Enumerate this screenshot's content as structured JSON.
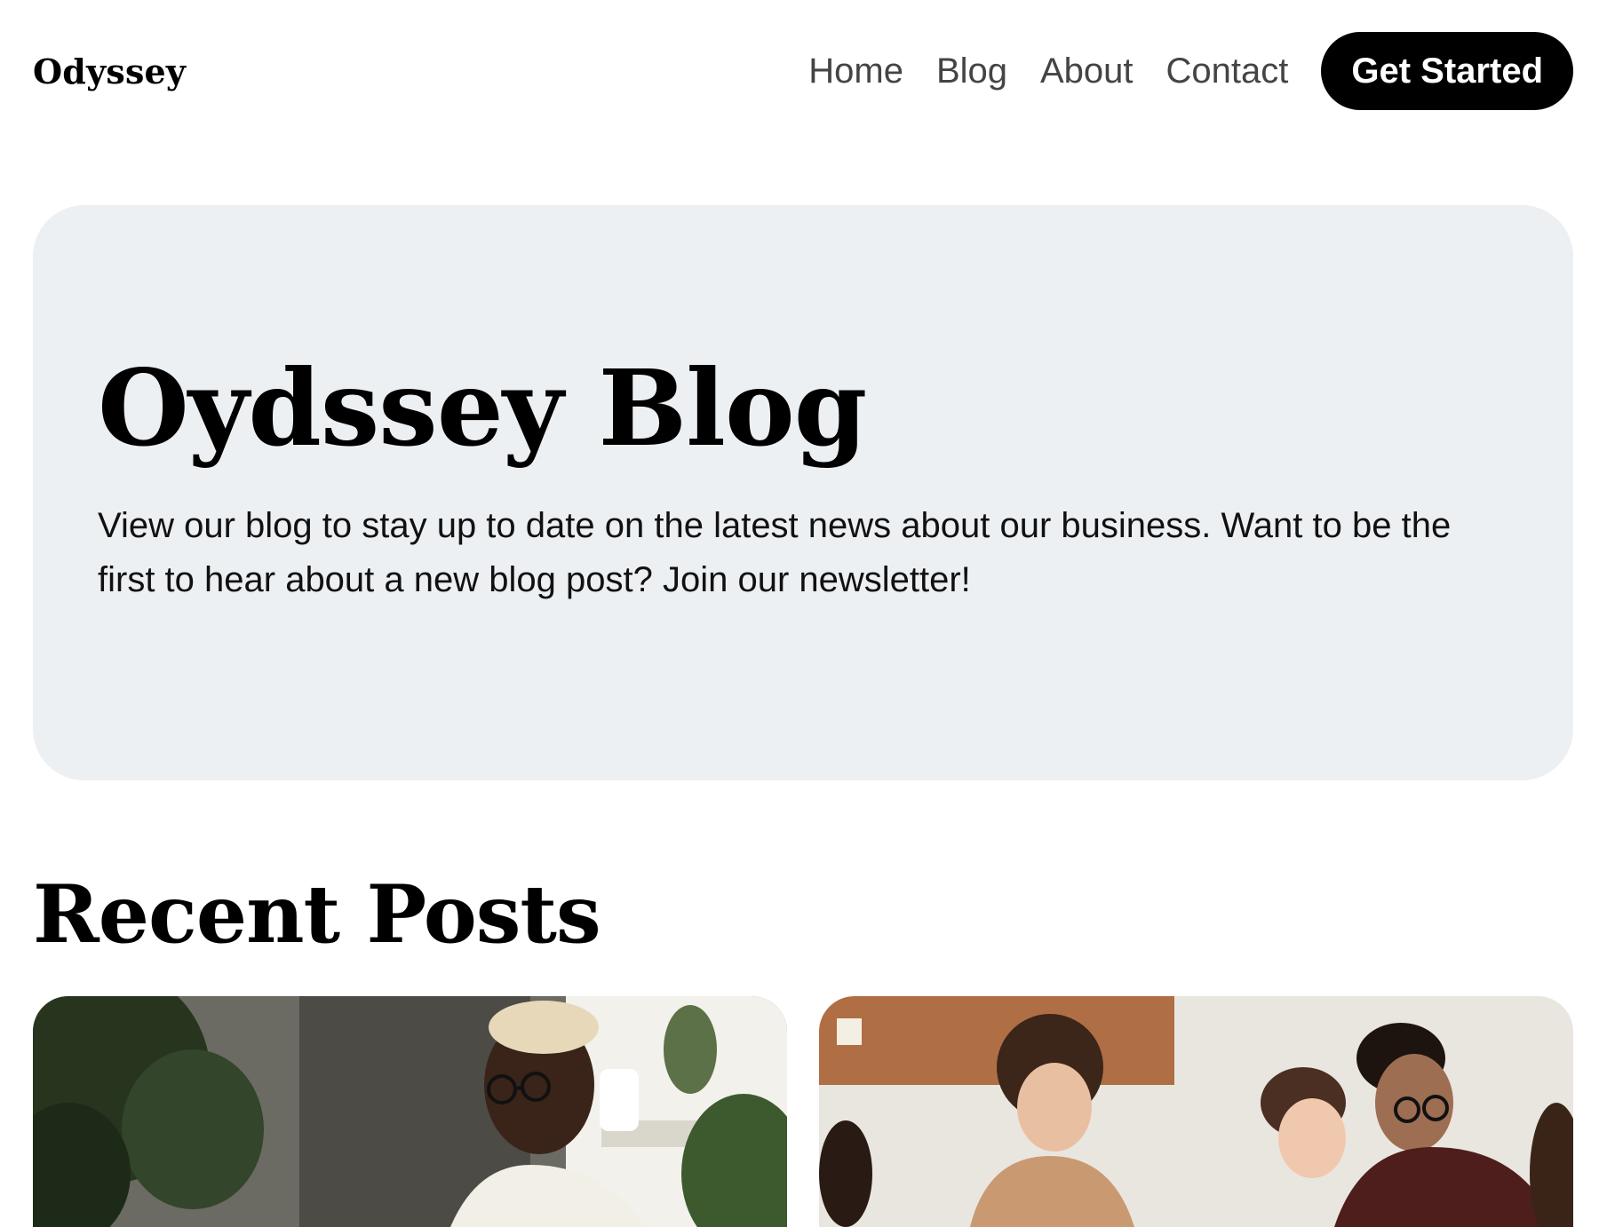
{
  "header": {
    "brand": "Odyssey",
    "nav": [
      {
        "label": "Home"
      },
      {
        "label": "Blog"
      },
      {
        "label": "About"
      },
      {
        "label": "Contact"
      }
    ],
    "cta_label": "Get Started"
  },
  "hero": {
    "title": "Oydssey Blog",
    "text": "View our blog to stay up to date on the latest news about our business. Want to be the first to hear about a new blog post? Join our newsletter!"
  },
  "recent": {
    "title": "Recent Posts",
    "posts": [
      {
        "image": "photo-man-with-glasses-at-laptop"
      },
      {
        "image": "photo-team-meeting"
      }
    ]
  },
  "colors": {
    "hero_bg": "#edf0f3",
    "cta_bg": "#000000",
    "nav_text": "#444444"
  }
}
